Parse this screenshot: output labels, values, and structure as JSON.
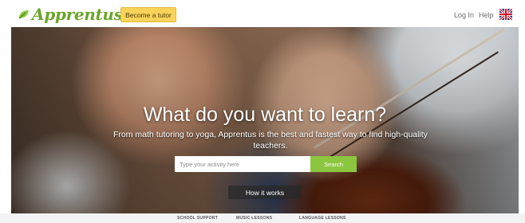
{
  "header": {
    "logo_text": "Apprentus",
    "become_tutor_label": "Become a tutor",
    "login_label": "Log In",
    "help_label": "Help",
    "language_flag": "uk-flag-icon",
    "brand_color": "#6aa52a",
    "button_color": "#f7d35a"
  },
  "hero": {
    "headline": "What do you want to learn?",
    "subheadline": "From math tutoring to yoga, Apprentus is the best and fastest way to find high-quality teachers.",
    "search": {
      "placeholder": "Type your activity here",
      "button_label": "Search",
      "button_color": "#8cc63f"
    },
    "how_it_works_label": "How it works"
  },
  "footer_strip": {
    "links": [
      "SCHOOL SUPPORT",
      "MUSIC LESSONS",
      "LANGUAGE LESSONS"
    ]
  }
}
